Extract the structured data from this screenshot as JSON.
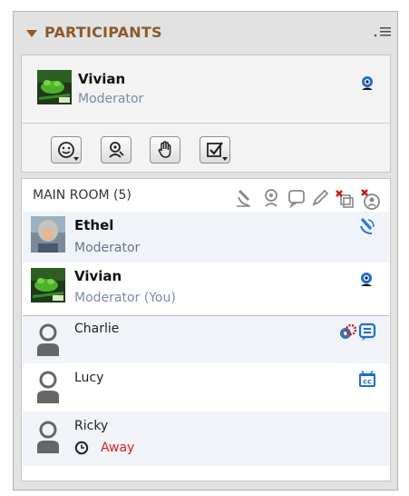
{
  "header": {
    "title": "PARTICIPANTS"
  },
  "self": {
    "name": "Vivian",
    "role": "Moderator"
  },
  "toolbar": {
    "buttons": [
      {
        "icon": "smiley-status-icon"
      },
      {
        "icon": "webcam-settings-icon"
      },
      {
        "icon": "raise-hand-icon"
      },
      {
        "icon": "checkbox-poll-icon"
      }
    ]
  },
  "room": {
    "title": "MAIN ROOM (5)",
    "participants": [
      {
        "name": "Ethel",
        "role": "Moderator",
        "status_icons": [
          "audio-icon"
        ]
      },
      {
        "name": "Vivian",
        "role": "Moderator (You)",
        "status_icons": [
          "webcam-icon"
        ]
      },
      {
        "name": "Charlie",
        "role": "",
        "status_icons": [
          "settings-alert-icon",
          "chat-icon"
        ]
      },
      {
        "name": "Lucy",
        "role": "",
        "status_icons": [
          "closed-caption-icon"
        ]
      },
      {
        "name": "Ricky",
        "role": "",
        "status": "Away",
        "status_icons": [
          "clock-icon"
        ]
      }
    ]
  },
  "colors": {
    "header_text": "#8a5a2b",
    "role_text": "#7b8ba6",
    "away": "#e02020",
    "accent_blue": "#1e6fd0"
  }
}
